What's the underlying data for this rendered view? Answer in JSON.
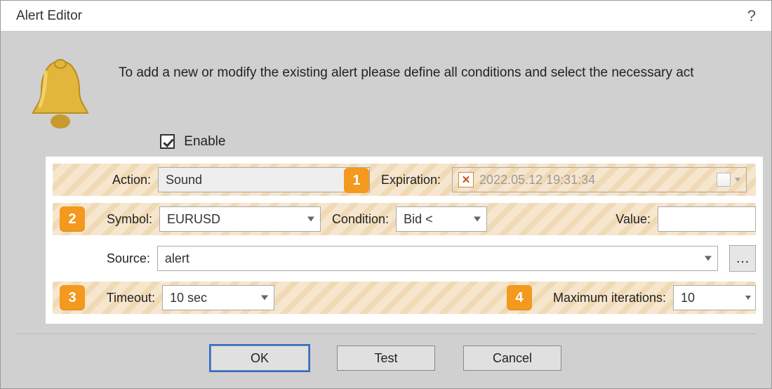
{
  "window": {
    "title": "Alert Editor",
    "help": "?"
  },
  "intro": "To add a new or modify the existing alert please define all conditions and select the necessary act",
  "enable": {
    "label": "Enable",
    "checked": true
  },
  "labels": {
    "action": "Action:",
    "expiration": "Expiration:",
    "symbol": "Symbol:",
    "condition": "Condition:",
    "value": "Value:",
    "source": "Source:",
    "timeout": "Timeout:",
    "max_iterations": "Maximum iterations:"
  },
  "fields": {
    "action": "Sound",
    "expiration_clear": "✕",
    "expiration_value": "2022.05.12 19:31:34",
    "symbol": "EURUSD",
    "condition": "Bid <",
    "value": "",
    "source": "alert",
    "timeout": "10 sec",
    "max_iterations": "10"
  },
  "markers": {
    "1": "1",
    "2": "2",
    "3": "3",
    "4": "4"
  },
  "buttons": {
    "ok": "OK",
    "test": "Test",
    "cancel": "Cancel",
    "browse": "…"
  },
  "colors": {
    "accent": "#f3991e",
    "primary": "#2a6ed6"
  }
}
